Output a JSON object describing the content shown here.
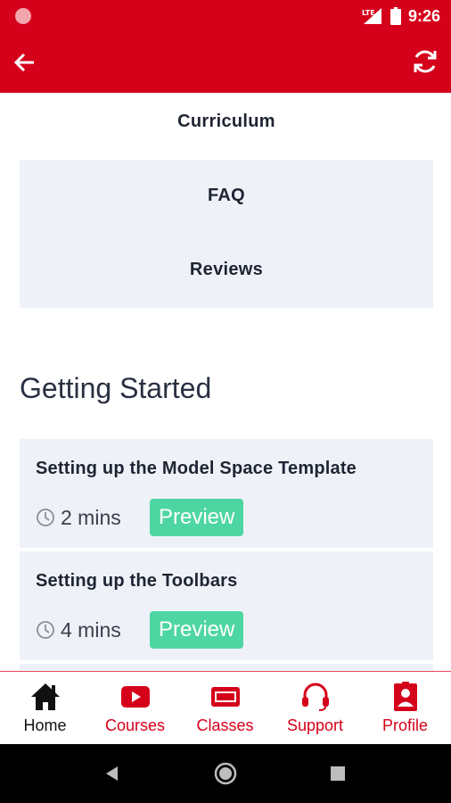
{
  "status_bar": {
    "time": "9:26",
    "network": "LTE"
  },
  "header": {
    "back_icon": "arrow-left-icon",
    "refresh_icon": "refresh-icon"
  },
  "tabs": [
    "Curriculum",
    "FAQ",
    "Reviews"
  ],
  "section": {
    "title": "Getting Started"
  },
  "lessons": [
    {
      "title": "Setting up the Model Space Template",
      "duration": "2 mins",
      "action": "Preview"
    },
    {
      "title": "Setting up the Toolbars",
      "duration": "4 mins",
      "action": "Preview"
    }
  ],
  "bottom_nav": [
    {
      "label": "Home",
      "icon": "home-icon",
      "active": true
    },
    {
      "label": "Courses",
      "icon": "video-icon",
      "active": false
    },
    {
      "label": "Classes",
      "icon": "live-icon",
      "active": false
    },
    {
      "label": "Support",
      "icon": "headset-icon",
      "active": false
    },
    {
      "label": "Profile",
      "icon": "profile-icon",
      "active": false
    }
  ],
  "colors": {
    "primary": "#d5011b",
    "preview": "#4ed6a2",
    "card_bg": "#eef2f8"
  }
}
